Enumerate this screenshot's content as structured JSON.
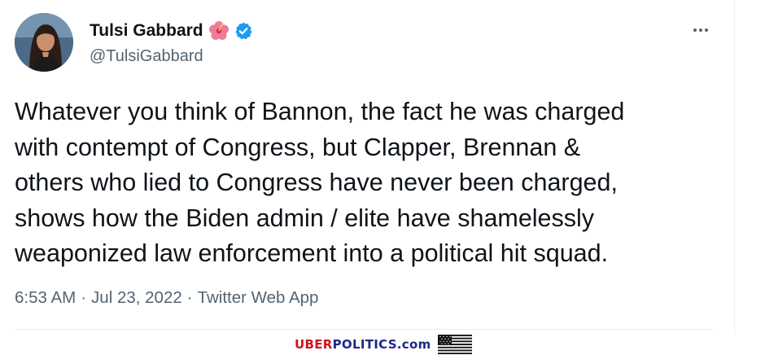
{
  "author": {
    "display_name": "Tulsi Gabbard",
    "handle": "@TulsiGabbard",
    "flower_icon": "hibiscus-emoji-icon",
    "verified_icon": "verified-badge-icon",
    "verified_color": "#1d9bf0"
  },
  "menu": {
    "icon": "more-horizontal-icon"
  },
  "tweet": {
    "lines": [
      "Whatever you think of Bannon, the fact he was charged",
      "with contempt of Congress, but Clapper, Brennan &",
      "others who lied to Congress have never been charged,",
      "shows how the Biden admin / elite have shamelessly",
      "weaponized law enforcement into a political hit squad."
    ]
  },
  "meta": {
    "time": "6:53 AM",
    "separator": "·",
    "date": "Jul 23, 2022",
    "source": "Twitter Web App"
  },
  "watermark": {
    "part1": "UBER",
    "part2": "POLITICS.com",
    "flag_icon": "us-flag-icon",
    "color_red": "#d0141c",
    "color_blue": "#1c2a86"
  }
}
